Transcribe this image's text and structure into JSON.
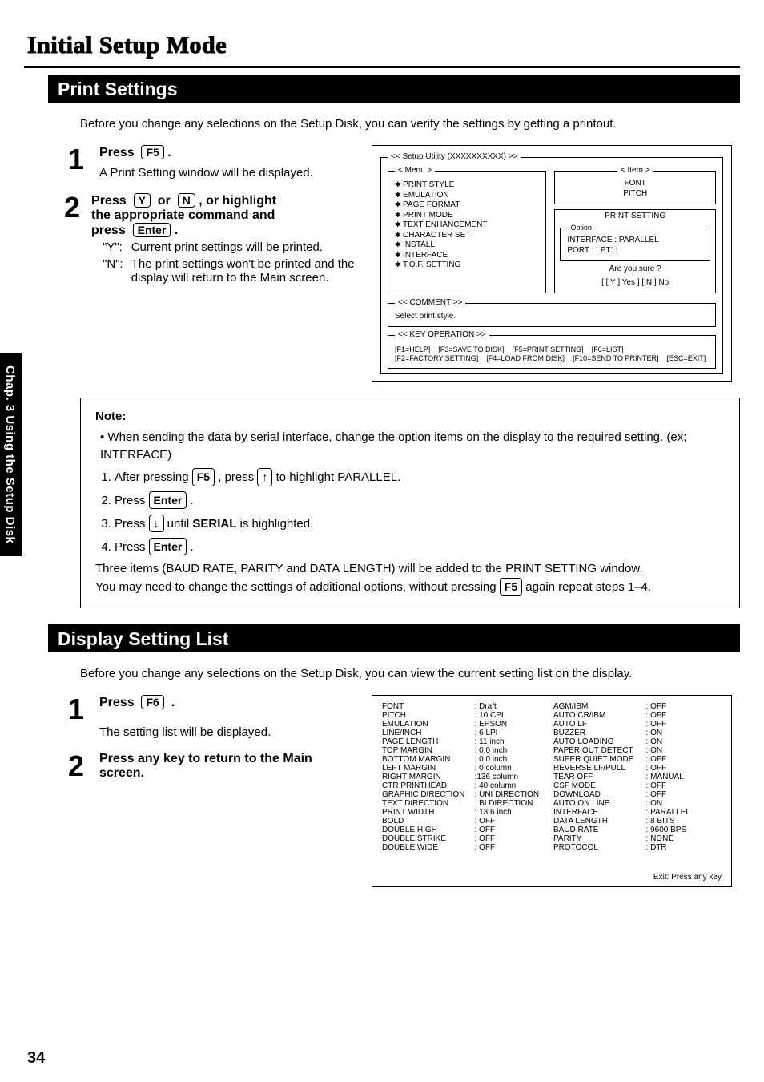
{
  "page_title": "Initial Setup Mode",
  "side_tab": "Chap. 3   Using the Setup Disk",
  "page_number": "34",
  "sec1": {
    "title": "Print Settings",
    "intro": "Before you change any selections on the Setup Disk, you can verify the settings by getting a printout.",
    "step1_press": "Press",
    "step1_key": "F5",
    "step1_body": "A Print Setting window will be displayed.",
    "step2_line1a": "Press",
    "step2_keyY": "Y",
    "step2_or": "or",
    "step2_keyN": "N",
    "step2_line1b": ", or highlight",
    "step2_line2": "the appropriate command and",
    "step2_line3a": "press",
    "step2_keyEnter": "Enter",
    "y_label": "\"Y\":",
    "y_text": "Current print settings will be printed.",
    "n_label": "\"N\":",
    "n_text": "The print settings won't be printed and the display will return to the Main screen."
  },
  "screen1": {
    "title": "<<  Setup Utility (XXXXXXXXXX)  >>",
    "menu_legend": "< Menu >",
    "menu_items": [
      "PRINT STYLE",
      "EMULATION",
      "PAGE FORMAT",
      "PRINT MODE",
      "TEXT ENHANCEMENT",
      "CHARACTER SET",
      "INSTALL",
      "INTERFACE",
      "T.O.F. SETTING"
    ],
    "item_legend": "< Item >",
    "item_lines": [
      "FONT",
      "PITCH"
    ],
    "ps_title": "PRINT SETTING",
    "opt_legend": "Option",
    "opt_l1": "INTERFACE     : PARALLEL",
    "opt_l2": "PORT               : LPT1:",
    "confirm": "Are you sure  ?",
    "yn": "[ [ Y ] Yes ]    [ N ]  No",
    "comment_legend": "<<  COMMENT  >>",
    "comment_text": "Select print style.",
    "keyop_legend": "<<  KEY OPERATION  >>",
    "kops": [
      "[F1=HELP]",
      "[F3=SAVE TO DISK]",
      "[F5=PRINT SETTING]",
      "[F6=LIST]",
      "[F2=FACTORY SETTING]",
      "[F4=LOAD FROM DISK]",
      "[F10=SEND TO PRINTER]",
      "[ESC=EXIT]"
    ]
  },
  "note": {
    "label": "Note:",
    "bullet": "When sending the data by serial interface, change the option items on the display to the required setting. (ex;  INTERFACE)",
    "li1a": "After pressing ",
    "li1_key1": "F5",
    "li1b": " , press ",
    "li1_key2": "↑",
    "li1c": " to highlight PARALLEL.",
    "li2a": "Press ",
    "li2_key": "Enter",
    "li2b": " .",
    "li3a": "Press ",
    "li3_key": "↓",
    "li3b": " until ",
    "li3_bold": "SERIAL",
    "li3c": " is highlighted.",
    "li4a": "Press ",
    "li4_key": "Enter",
    "li4b": "  .",
    "tail1": "Three items (BAUD RATE, PARITY and DATA LENGTH) will be added to the PRINT SETTING window.",
    "tail2a": "You may need to change the settings of additional options, without pressing ",
    "tail2_key": "F5",
    "tail2b": " again repeat steps 1–4."
  },
  "sec2": {
    "title": "Display Setting List",
    "intro": "Before you change any selections on the Setup Disk, you can view the current setting list on the display.",
    "step1_press": "Press",
    "step1_key": "F6",
    "step1_body": "The setting list will be displayed.",
    "step2": "Press any key to return to the Main screen."
  },
  "settings": {
    "left": [
      [
        "FONT",
        ": Draft"
      ],
      [
        "PITCH",
        ": 10   CPI"
      ],
      [
        "EMULATION",
        ": EPSON"
      ],
      [
        "LINE/INCH",
        ":  6   LPI"
      ],
      [
        "PAGE LENGTH",
        ": 11   inch"
      ],
      [
        "TOP MARGIN",
        ":  0.0 inch"
      ],
      [
        "BOTTOM MARGIN",
        ":  0.0 inch"
      ],
      [
        "LEFT MARGIN",
        ":  0   column"
      ],
      [
        "RIGHT MARGIN",
        ":136   column"
      ],
      [
        "CTR PRINTHEAD",
        ": 40   column"
      ],
      [
        "GRAPHIC DIRECTION",
        ": UNI DIRECTION"
      ],
      [
        "TEXT DIRECTION",
        ": BI DIRECTION"
      ],
      [
        "PRINT WIDTH",
        ": 13.6   inch"
      ],
      [
        "BOLD",
        ": OFF"
      ],
      [
        "DOUBLE HIGH",
        ": OFF"
      ],
      [
        "DOUBLE STRIKE",
        ": OFF"
      ],
      [
        "DOUBLE WIDE",
        ": OFF"
      ]
    ],
    "right": [
      [
        "AGM/IBM",
        ": OFF"
      ],
      [
        "AUTO CR/IBM",
        ": OFF"
      ],
      [
        "AUTO LF",
        ": OFF"
      ],
      [
        "BUZZER",
        ": ON"
      ],
      [
        "AUTO LOADING",
        ": ON"
      ],
      [
        "PAPER OUT DETECT",
        ": ON"
      ],
      [
        "SUPER QUIET MODE",
        ": OFF"
      ],
      [
        "REVERSE LF/PULL",
        ": OFF"
      ],
      [
        "TEAR OFF",
        ": MANUAL"
      ],
      [
        "CSF MODE",
        ": OFF"
      ],
      [
        "DOWNLOAD",
        ": OFF"
      ],
      [
        "AUTO ON LINE",
        ": ON"
      ],
      [
        "INTERFACE",
        ": PARALLEL"
      ],
      [
        "DATA LENGTH",
        ": 8 BITS"
      ],
      [
        "BAUD RATE",
        ": 9600 BPS"
      ],
      [
        "PARITY",
        ": NONE"
      ],
      [
        "PROTOCOL",
        ": DTR"
      ]
    ],
    "exit": "Exit:  Press any key."
  }
}
